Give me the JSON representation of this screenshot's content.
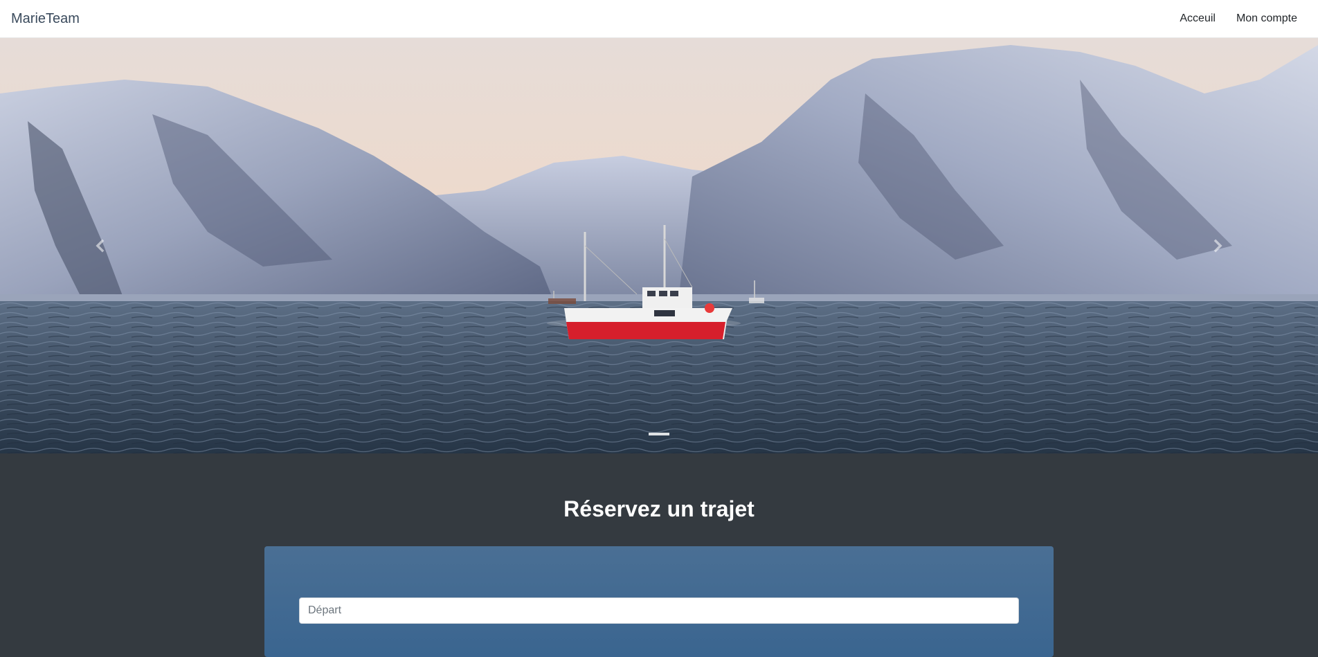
{
  "navbar": {
    "brand": "MarieTeam",
    "links": [
      {
        "label": "Acceuil"
      },
      {
        "label": "Mon compte"
      }
    ]
  },
  "carousel": {
    "active_index": 0,
    "indicator_count": 1,
    "prev_icon": "chevron-left-icon",
    "next_icon": "chevron-right-icon"
  },
  "booking": {
    "title": "Réservez un trajet",
    "depart_placeholder": "Départ"
  },
  "colors": {
    "navbar_bg": "#ffffff",
    "section_bg": "#343a40",
    "card_bg": "#3f6890",
    "boat_red": "#d61f2c"
  }
}
